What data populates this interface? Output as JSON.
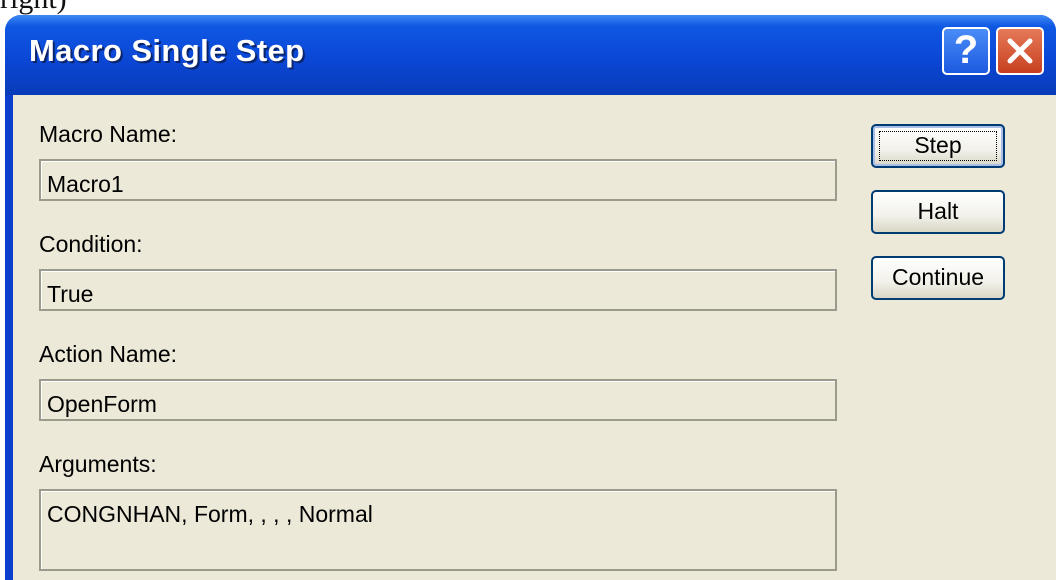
{
  "background_fragment": "right)",
  "window": {
    "title": "Macro Single Step",
    "help_symbol": "?"
  },
  "fields": {
    "macro_name": {
      "label": "Macro Name:",
      "value": "Macro1"
    },
    "condition": {
      "label": "Condition:",
      "value": "True"
    },
    "action_name": {
      "label": "Action Name:",
      "value": "OpenForm"
    },
    "arguments": {
      "label": "Arguments:",
      "value": "CONGNHAN, Form, , , , Normal"
    }
  },
  "buttons": {
    "step": "Step",
    "halt": "Halt",
    "continue": "Continue"
  },
  "colors": {
    "titlebar": "#0b47d6",
    "client": "#ece9d8",
    "close": "#c8401e",
    "button_border": "#003c74"
  }
}
